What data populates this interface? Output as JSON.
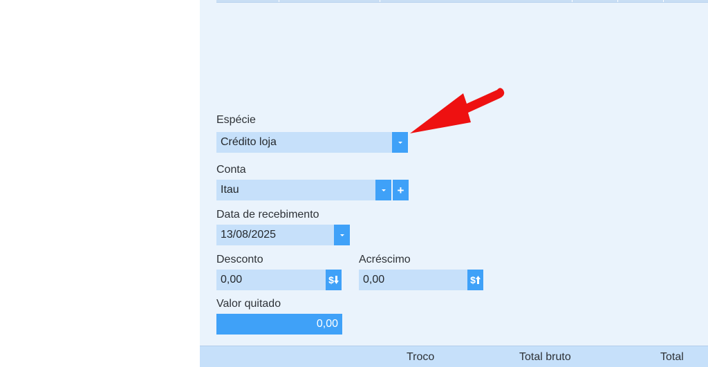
{
  "form": {
    "especie": {
      "label": "Espécie",
      "value": "Crédito loja"
    },
    "conta": {
      "label": "Conta",
      "value": "Itau"
    },
    "data_recebimento": {
      "label": "Data de recebimento",
      "value": "13/08/2025"
    },
    "desconto": {
      "label": "Desconto",
      "value": "0,00"
    },
    "acrescimo": {
      "label": "Acréscimo",
      "value": "0,00"
    },
    "valor_quitado": {
      "label": "Valor quitado",
      "value": "0,00"
    }
  },
  "footer": {
    "troco_label": "Troco",
    "total_bruto_label": "Total bruto",
    "total_label": "Total"
  },
  "annotation": {
    "arrow_color": "#ee1111"
  },
  "colors": {
    "accent": "#3fa1f8",
    "field_bg": "#c6e0fa",
    "panel_bg": "#eaf3fc"
  }
}
